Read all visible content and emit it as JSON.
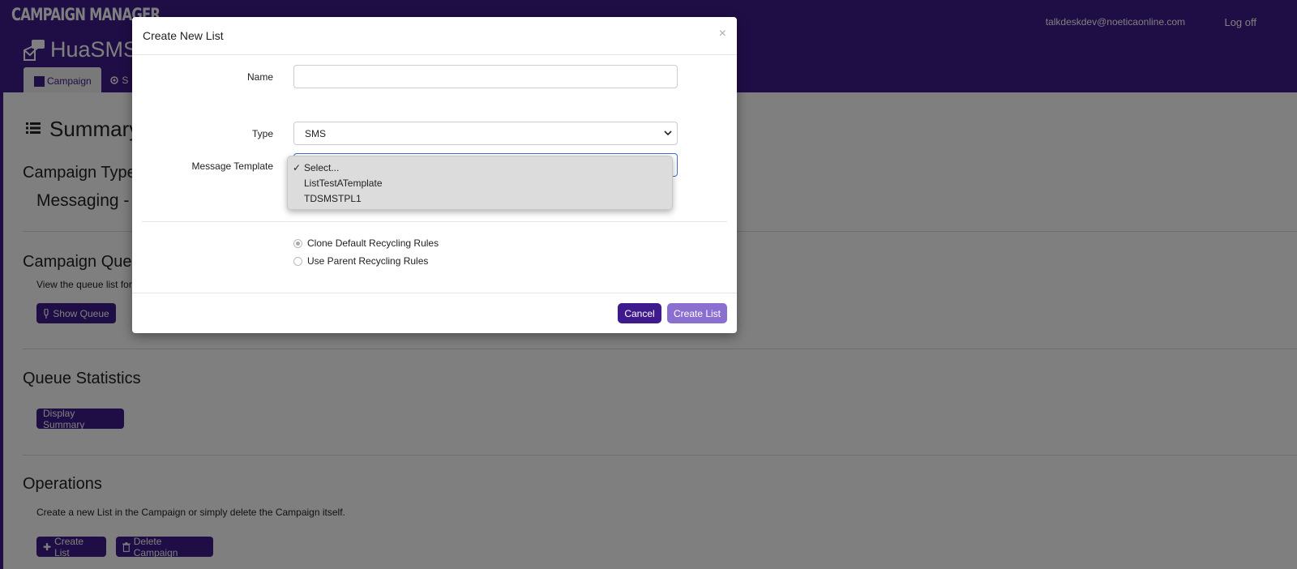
{
  "topbar": {
    "brand": "CAMPAIGN MANAGER",
    "user_email": "talkdeskdev@noeticaonline.com",
    "logoff_label": "Log off"
  },
  "header": {
    "app_title": "HuaSMS",
    "tabs": [
      {
        "label": "Campaign"
      },
      {
        "label": "S"
      }
    ]
  },
  "content": {
    "summary_title": "Summary",
    "campaign_type": {
      "title": "Campaign Type",
      "value": "Messaging -"
    },
    "campaign_queue": {
      "title": "Campaign Queu",
      "desc": "View the queue list for",
      "button_label": "Show Queue"
    },
    "queue_statistics": {
      "title": "Queue Statistics",
      "button_label": "Display Summary"
    },
    "operations": {
      "title": "Operations",
      "desc": "Create a new List in the Campaign or simply delete the Campaign itself.",
      "create_list_label": "Create List",
      "delete_campaign_label": "Delete Campaign"
    }
  },
  "modal": {
    "title": "Create New List",
    "close_glyph": "×",
    "name_label": "Name",
    "name_value": "",
    "type_label": "Type",
    "type_value": "SMS",
    "template_label": "Message Template",
    "template_options": [
      {
        "label": "Select...",
        "selected": true
      },
      {
        "label": "ListTestATemplate",
        "selected": false
      },
      {
        "label": "TDSMSTPL1",
        "selected": false
      }
    ],
    "recycling_options": [
      {
        "label": "Clone Default Recycling Rules",
        "checked": true
      },
      {
        "label": "Use Parent Recycling Rules",
        "checked": false
      }
    ],
    "cancel_label": "Cancel",
    "create_label": "Create List"
  },
  "colors": {
    "brand_purple": "#3f1a8c",
    "button_disabled": "#8a6fd1",
    "overlay": "rgba(0,0,0,0.5)"
  },
  "icons": [
    "campaign-square-icon",
    "gear-icon",
    "list-icon",
    "microphone-icon",
    "plus-icon",
    "trash-icon",
    "chevron-down-icon",
    "checkmark-icon"
  ]
}
